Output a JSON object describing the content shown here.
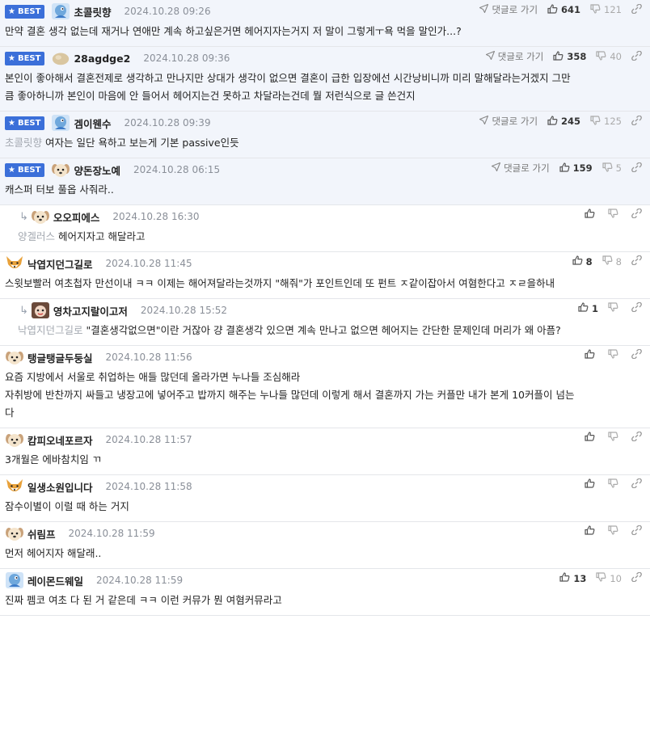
{
  "comments": [
    {
      "best": true,
      "reply": false,
      "avatar": "blue-bird",
      "nick": "초콜릿향",
      "date": "2024.10.28 09:26",
      "goto": "댓글로 가기",
      "up": "641",
      "down": "121",
      "mention": "",
      "lines": [
        "만약 결혼 생각 없는데 재거나 연애만 계속 하고싶은거면 헤어지자는거지 저 말이 그렇게ㅜ욕 먹을 말인가...?"
      ]
    },
    {
      "best": true,
      "reply": false,
      "avatar": "beige-blob",
      "nick": "28agdge2",
      "date": "2024.10.28 09:36",
      "goto": "댓글로 가기",
      "up": "358",
      "down": "40",
      "mention": "",
      "lines": [
        "본인이 좋아해서 결혼전제로 생각하고 만나지만 상대가 생각이 없으면 결혼이 급한 입장에선 시간낭비니까 미리 말해달라는거겠지 그만",
        "큼 좋아하니까 본인이 마음에 안 들어서 헤어지는건 못하고 차달라는건데 뭘 저런식으로 글 쓴건지"
      ]
    },
    {
      "best": true,
      "reply": false,
      "avatar": "blue-bird",
      "nick": "겜이웬수",
      "date": "2024.10.28 09:39",
      "goto": "댓글로 가기",
      "up": "245",
      "down": "125",
      "mention": "초콜릿향",
      "lines": [
        "여자는 일단 욕하고 보는게 기본 passive인듯"
      ]
    },
    {
      "best": true,
      "reply": false,
      "avatar": "puppy",
      "nick": "양돈장노예",
      "date": "2024.10.28 06:15",
      "goto": "댓글로 가기",
      "up": "159",
      "down": "5",
      "mention": "",
      "lines": [
        "캐스퍼 터보 풀옵 사줘라.."
      ]
    },
    {
      "best": false,
      "reply": true,
      "avatar": "puppy",
      "nick": "오오피에스",
      "date": "2024.10.28 16:30",
      "goto": "",
      "up": "",
      "down": "",
      "mention": "양겔러스",
      "lines": [
        "헤어지자고 해달라고"
      ]
    },
    {
      "best": false,
      "reply": false,
      "avatar": "fox",
      "nick": "낙엽지던그길로",
      "date": "2024.10.28 11:45",
      "goto": "",
      "up": "8",
      "down": "8",
      "mention": "",
      "lines": [
        "스윗보빨러 여초첩자 만선이내 ㅋㅋ 이제는 해어져달라는것까지 \"해줘\"가 포인트인데 또 펀트 ㅈ같이잡아서 여혐한다고 ㅈㄹ을하내"
      ]
    },
    {
      "best": false,
      "reply": true,
      "avatar": "dark-animal",
      "nick": "영차고지랄이고저",
      "date": "2024.10.28 15:52",
      "goto": "",
      "up": "1",
      "down": "",
      "mention": "낙엽지던그길로",
      "lines": [
        "\"결혼생각없으면\"이란 거잖아 걍 결혼생각 있으면 계속 만나고 없으면 헤어지는 간단한 문제인데 머리가 왜 아픔?"
      ]
    },
    {
      "best": false,
      "reply": false,
      "avatar": "puppy",
      "nick": "탱글탱글두둥실",
      "date": "2024.10.28 11:56",
      "goto": "",
      "up": "",
      "down": "",
      "mention": "",
      "lines": [
        "요즘 지방에서 서울로 취업하는 애들 많던데 올라가면 누나들 조심해라",
        "자취방에 반찬까지 싸들고 냉장고에 넣어주고 밥까지 해주는 누나들 많던데 이렇게 해서 결혼까지 가는 커플만 내가 본게 10커플이 넘는",
        "다"
      ]
    },
    {
      "best": false,
      "reply": false,
      "avatar": "puppy",
      "nick": "캄피오네포르자",
      "date": "2024.10.28 11:57",
      "goto": "",
      "up": "",
      "down": "",
      "mention": "",
      "lines": [
        "3개월은 에바참치임 ㄲ"
      ]
    },
    {
      "best": false,
      "reply": false,
      "avatar": "fox",
      "nick": "일생소원입니다",
      "date": "2024.10.28 11:58",
      "goto": "",
      "up": "",
      "down": "",
      "mention": "",
      "lines": [
        "잠수이별이 이럴 때 하는 거지"
      ]
    },
    {
      "best": false,
      "reply": false,
      "avatar": "puppy",
      "nick": "쉬림프",
      "date": "2024.10.28 11:59",
      "goto": "",
      "up": "",
      "down": "",
      "mention": "",
      "lines": [
        "먼저 헤어지자 해달래.."
      ]
    },
    {
      "best": false,
      "reply": false,
      "avatar": "blue-bird",
      "nick": "레이몬드웨일",
      "date": "2024.10.28 11:59",
      "goto": "",
      "up": "13",
      "down": "10",
      "mention": "",
      "lines": [
        "진짜 펨코 여초 다 된 거 같은데 ㅋㅋ 이런 커뮤가 뭔 여혐커뮤라고"
      ]
    }
  ],
  "badge_label": "BEST",
  "colors": {
    "badge": "#3b6fd9",
    "best_bg": "#f2f5fb",
    "mention": "#a3a8b0",
    "date": "#8a8f98"
  }
}
